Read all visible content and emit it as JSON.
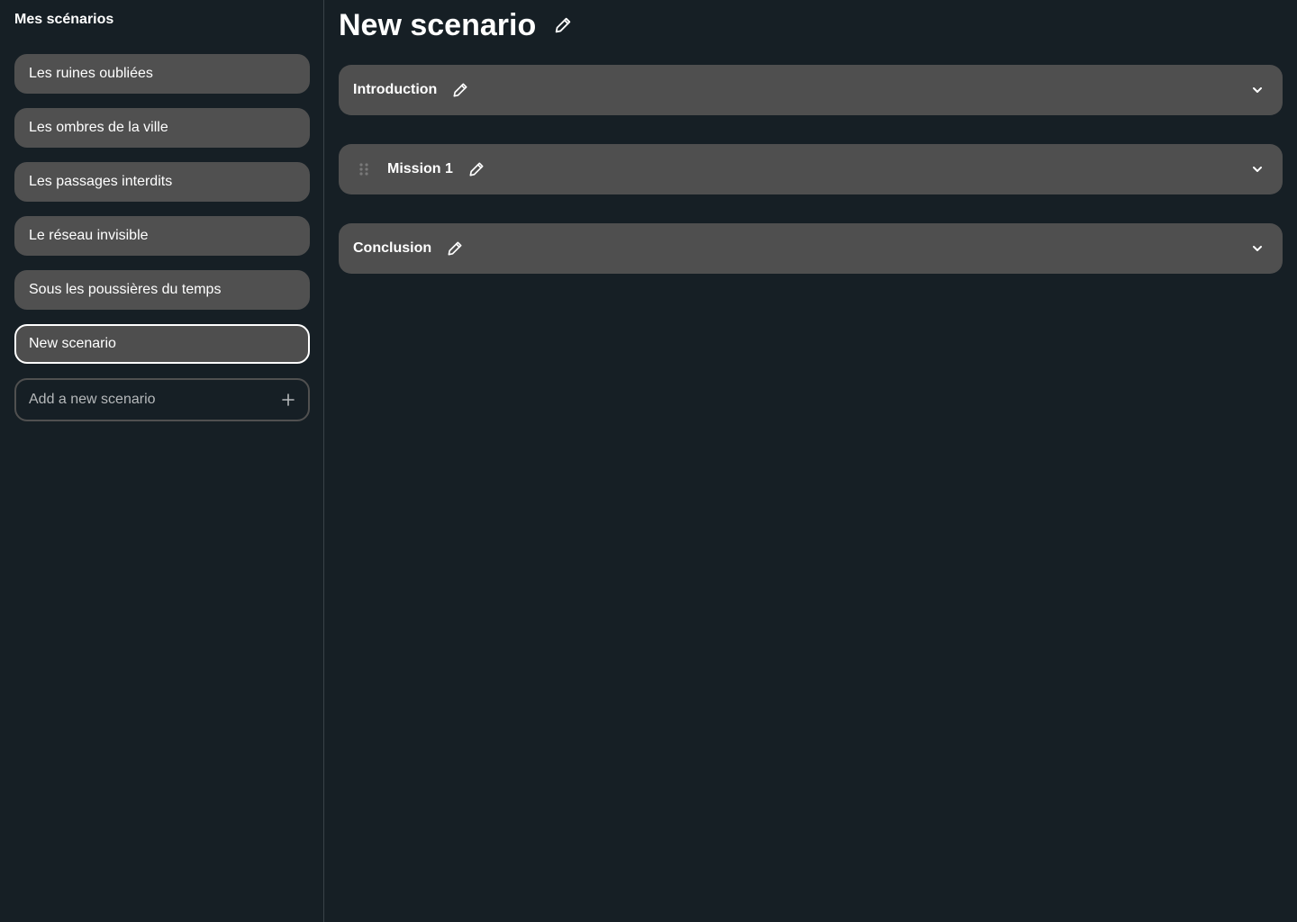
{
  "sidebar": {
    "title": "Mes scénarios",
    "items": [
      {
        "label": "Les ruines oubliées"
      },
      {
        "label": "Les ombres de la ville"
      },
      {
        "label": "Les passages interdits"
      },
      {
        "label": "Le réseau invisible"
      },
      {
        "label": "Sous les poussières du temps"
      },
      {
        "label": "New scenario",
        "active": true
      }
    ],
    "add_placeholder": "Add a new scenario"
  },
  "main": {
    "title": "New scenario",
    "sections": [
      {
        "label": "Introduction",
        "draggable": false
      },
      {
        "label": "Mission 1",
        "draggable": true
      },
      {
        "label": "Conclusion",
        "draggable": false
      }
    ]
  },
  "colors": {
    "background": "#161f25",
    "card": "#4f4f4f",
    "text": "#ffffff",
    "muted_text": "#b6b9bb",
    "active_border": "#ffffff"
  },
  "icons": {
    "edit": "pencil-icon",
    "add": "plus-icon",
    "expand": "chevron-down-icon",
    "drag": "drag-handle-icon"
  }
}
